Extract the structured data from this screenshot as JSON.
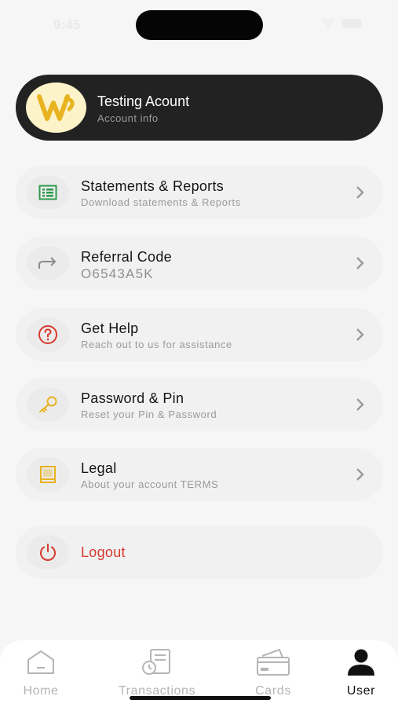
{
  "status_bar": {
    "time": "9:45"
  },
  "account": {
    "name": "Testing Acount",
    "subtitle": "Account info",
    "logo_text": "W"
  },
  "menu": [
    {
      "title": "Statements & Reports",
      "subtitle": "Download statements & Reports",
      "icon": "statement-icon",
      "color": "#2e9a4d"
    },
    {
      "title": "Referral Code",
      "subtitle": "O6543A5K",
      "icon": "share-arrow-icon",
      "color": "#8a8a8a"
    },
    {
      "title": "Get Help",
      "subtitle": "Reach out to us for assistance",
      "icon": "question-circle-icon",
      "color": "#d83a2e"
    },
    {
      "title": "Password & Pin",
      "subtitle": "Reset your Pin & Password",
      "icon": "key-icon",
      "color": "#e8b320"
    },
    {
      "title": "Legal",
      "subtitle": "About your account TERMS",
      "icon": "book-icon",
      "color": "#e8b320"
    }
  ],
  "logout": {
    "label": "Logout",
    "icon": "power-icon",
    "color": "#d83a2e"
  },
  "tabs": [
    {
      "label": "Home",
      "icon": "home-icon"
    },
    {
      "label": "Transactions",
      "icon": "transactions-icon"
    },
    {
      "label": "Cards",
      "icon": "card-icon"
    },
    {
      "label": "User",
      "icon": "user-icon",
      "active": true
    }
  ],
  "colors": {
    "card_bg": "#222222",
    "accent_red": "#d83a2e",
    "accent_yellow": "#e8b320",
    "accent_green": "#2e9a4d"
  }
}
